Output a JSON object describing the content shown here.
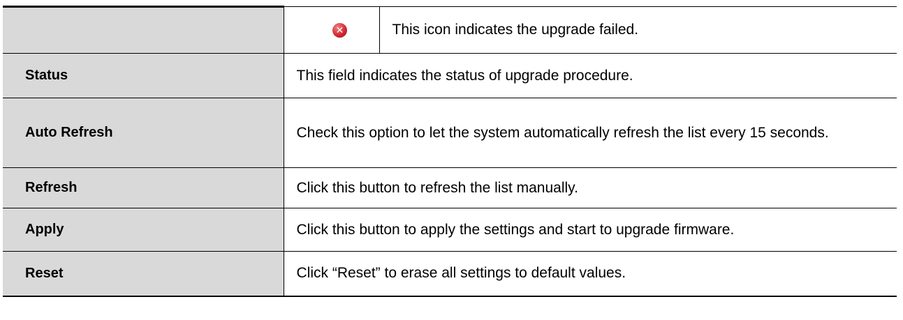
{
  "icon_row": {
    "icon": "error-x-icon",
    "description": "This icon indicates the upgrade failed."
  },
  "rows": [
    {
      "parameter": "Status",
      "description": "This field indicates the status of upgrade procedure."
    },
    {
      "parameter": "Auto Refresh",
      "description": "Check this option to let the system automatically refresh the list every 15 seconds."
    },
    {
      "parameter": "Refresh",
      "description": "Click this button to refresh the list manually."
    },
    {
      "parameter": "Apply",
      "description": "Click this button to apply the settings and start to upgrade firmware."
    },
    {
      "parameter": "Reset",
      "description": "Click “Reset” to erase all settings to default values."
    }
  ],
  "colors": {
    "label_bg": "#d9d9d9",
    "error_icon": "#d0242e"
  }
}
